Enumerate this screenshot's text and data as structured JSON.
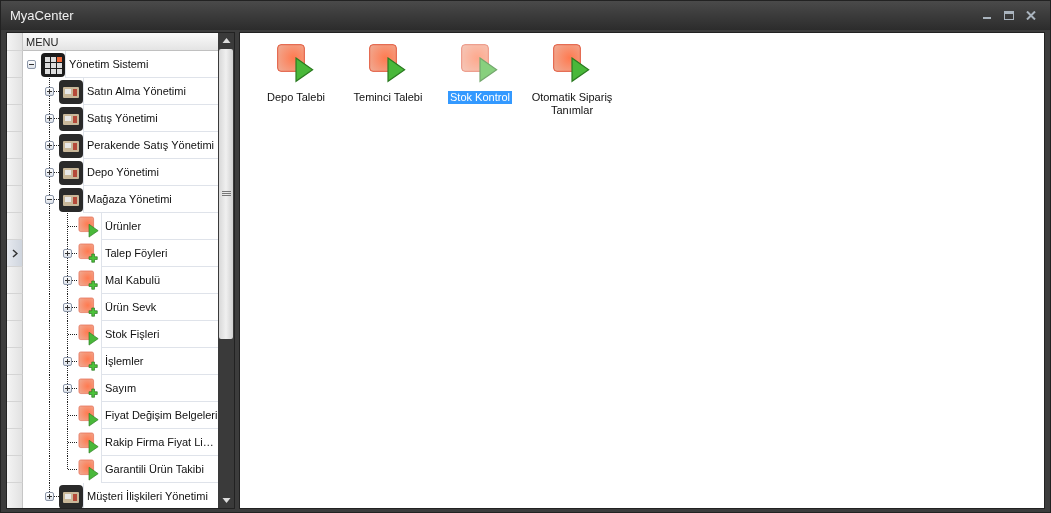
{
  "window": {
    "title": "MyaCenter"
  },
  "tree": {
    "header": "MENU",
    "items": [
      {
        "label": "Yönetim Sistemi",
        "kind": "root",
        "expanded": true,
        "focused": false,
        "children": [
          {
            "label": "Satın Alma Yönetimi",
            "kind": "module",
            "expanded": false,
            "focused": false
          },
          {
            "label": "Satış Yönetimi",
            "kind": "module",
            "expanded": false,
            "focused": false
          },
          {
            "label": "Perakende Satış Yönetimi",
            "kind": "module",
            "expanded": false,
            "focused": false
          },
          {
            "label": "Depo Yönetimi",
            "kind": "module",
            "expanded": false,
            "focused": false
          },
          {
            "label": "Mağaza Yönetimi",
            "kind": "module",
            "expanded": true,
            "focused": false,
            "children": [
              {
                "label": "Ürünler",
                "kind": "form",
                "focused": false
              },
              {
                "label": "Talep Föyleri",
                "kind": "group",
                "expanded": false,
                "focused": true
              },
              {
                "label": "Mal Kabulü",
                "kind": "group",
                "expanded": false,
                "focused": false
              },
              {
                "label": "Ürün Sevk",
                "kind": "group",
                "expanded": false,
                "focused": false
              },
              {
                "label": "Stok Fişleri",
                "kind": "form",
                "focused": false
              },
              {
                "label": "İşlemler",
                "kind": "group",
                "expanded": false,
                "focused": false
              },
              {
                "label": "Sayım",
                "kind": "group",
                "expanded": false,
                "focused": false
              },
              {
                "label": "Fiyat Değişim Belgeleri",
                "kind": "form",
                "focused": false
              },
              {
                "label": "Rakip Firma Fiyat Li…",
                "kind": "form",
                "focused": false
              },
              {
                "label": "Garantili Ürün Takibi",
                "kind": "form",
                "focused": false
              }
            ]
          },
          {
            "label": "Müşteri İlişkileri Yönetimi",
            "kind": "module",
            "expanded": false,
            "focused": false
          }
        ]
      }
    ]
  },
  "launcher": {
    "items": [
      {
        "label": "Depo Talebi",
        "selected": false
      },
      {
        "label": "Teminci Talebi",
        "selected": false
      },
      {
        "label": "Stok Kontrol",
        "selected": true
      },
      {
        "label": "Otomatik Sipariş Tanımlar",
        "selected": false
      }
    ]
  }
}
